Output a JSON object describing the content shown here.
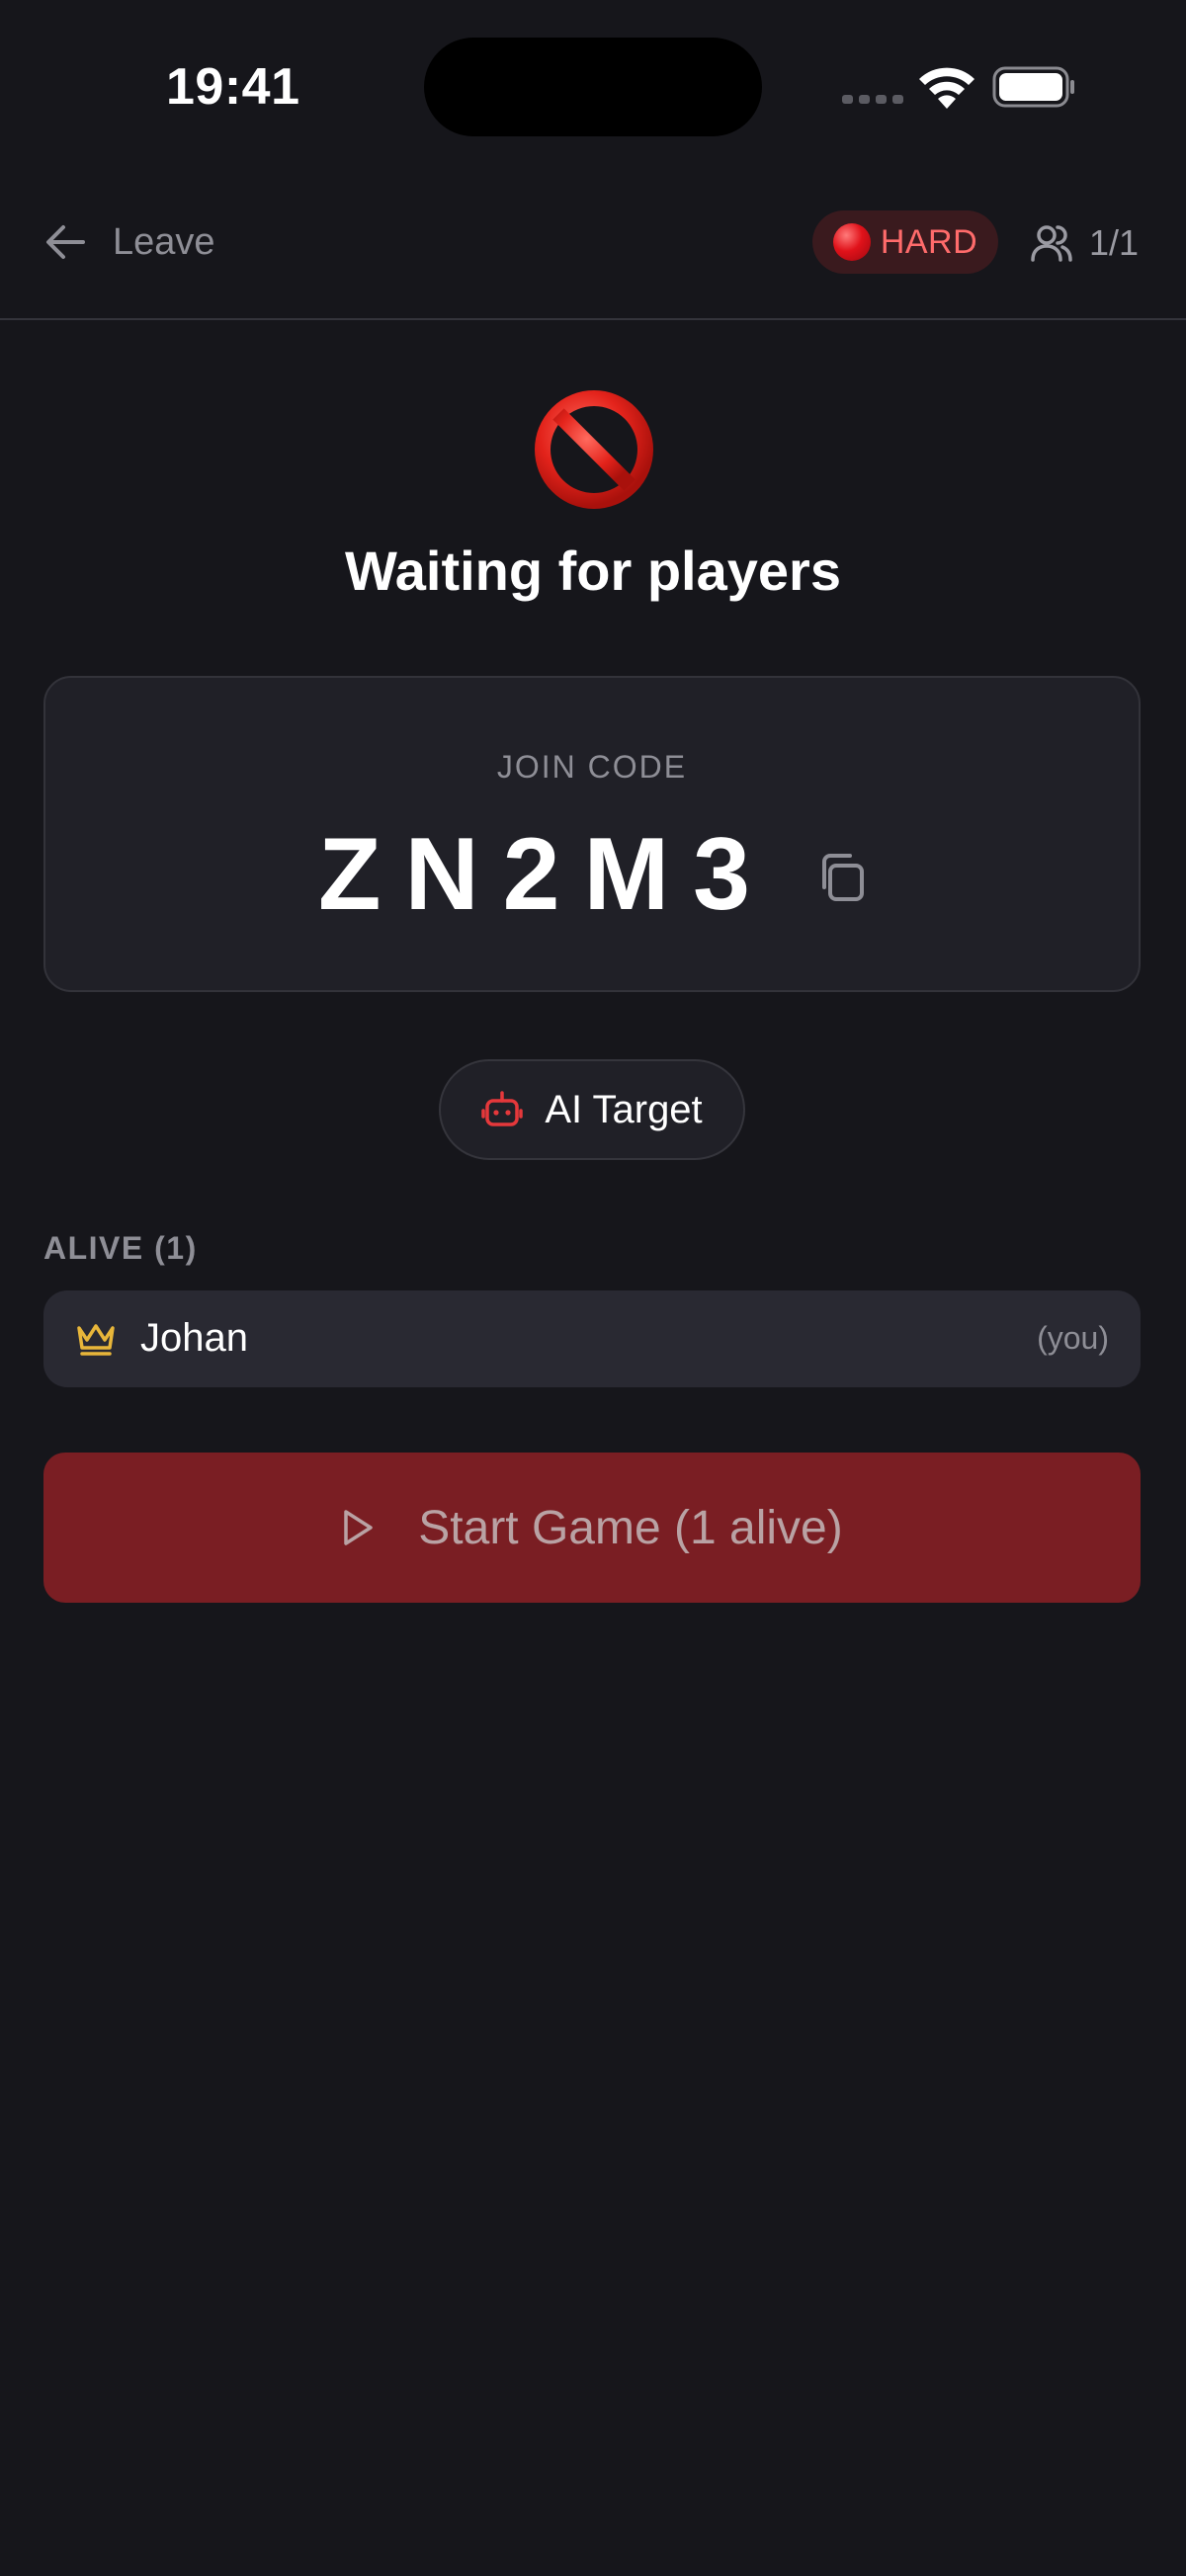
{
  "status_bar": {
    "time": "19:41"
  },
  "header": {
    "leave_label": "Leave",
    "difficulty_label": "HARD",
    "player_count": "1/1"
  },
  "hero": {
    "title": "Waiting for players"
  },
  "join_code": {
    "caption": "JOIN CODE",
    "code": "ZN2M3"
  },
  "ai_target": {
    "label": "AI Target"
  },
  "alive": {
    "section_title": "ALIVE (1)",
    "players": [
      {
        "name": "Johan",
        "tag": "(you)"
      }
    ]
  },
  "start_button": {
    "label": "Start Game (1 alive)"
  },
  "colors": {
    "background": "#16161b",
    "accent_red": "#e0121a",
    "start_button": "#7a1e23",
    "crown": "#e8b63a",
    "ai_icon": "#e5383b"
  },
  "icons": [
    "back-arrow-icon",
    "red-circle-icon",
    "users-icon",
    "prohibited-icon",
    "copy-icon",
    "robot-icon",
    "crown-icon",
    "play-icon"
  ]
}
